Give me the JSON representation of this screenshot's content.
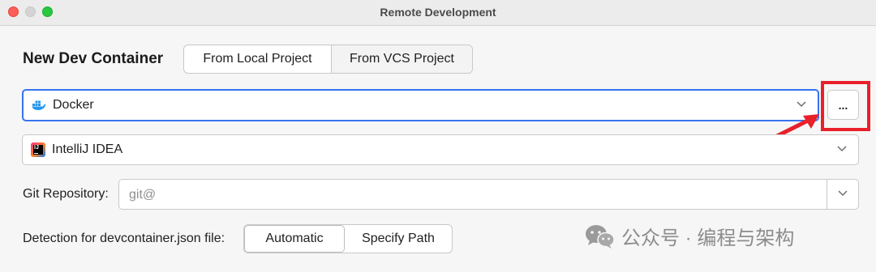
{
  "window": {
    "title": "Remote Development"
  },
  "header": {
    "title": "New Dev Container"
  },
  "source_tabs": [
    {
      "label": "From Local Project",
      "selected": false
    },
    {
      "label": "From VCS Project",
      "selected": true
    }
  ],
  "docker": {
    "value": "Docker",
    "icon": "docker-icon",
    "browse_label": "..."
  },
  "ide": {
    "value": "IntelliJ IDEA",
    "icon": "intellij-icon",
    "badge": "IJ"
  },
  "git": {
    "label": "Git Repository:",
    "placeholder": "git@"
  },
  "detection": {
    "label": "Detection for devcontainer.json file:",
    "options": [
      {
        "label": "Automatic",
        "selected": true
      },
      {
        "label": "Specify Path",
        "selected": false
      }
    ]
  },
  "annotation": {
    "color": "#e8202a"
  },
  "watermark": {
    "text": "公众号 · 编程与架构",
    "icon": "wechat-icon"
  },
  "colors": {
    "accent": "#3574f0",
    "highlight": "#e8202a"
  }
}
